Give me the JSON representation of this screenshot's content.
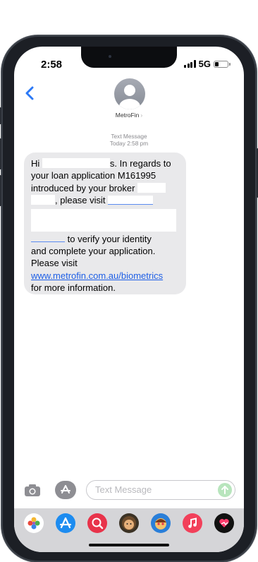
{
  "status_bar": {
    "time": "2:58",
    "network": "5G"
  },
  "contact": {
    "name": "MetroFin",
    "chevron": "›"
  },
  "timestamp": {
    "label": "Text Message",
    "time": "Today 2:58 pm"
  },
  "message": {
    "greeting": "Hi",
    "line1_tail": "s. In regards to",
    "line2": "your loan application M161995",
    "line3": "introduced by your broker",
    "line4": ", please visit",
    "line5": "to verify your identity",
    "line6": "and complete your application.",
    "line7": "Please visit",
    "link": "www.metrofin.com.au/biometrics",
    "line8": "for more information."
  },
  "input": {
    "placeholder": "Text Message"
  },
  "app_drawer": {
    "icons": [
      "photos-icon",
      "app-store-icon",
      "web-search-icon",
      "memoji-icon",
      "memoji-sticker-icon",
      "music-icon",
      "digital-touch-icon"
    ]
  },
  "colors": {
    "bubble": "#e9e9eb",
    "link": "#1e5fe6",
    "back_chevron": "#2c79f6",
    "send": "#b8e5bd"
  }
}
